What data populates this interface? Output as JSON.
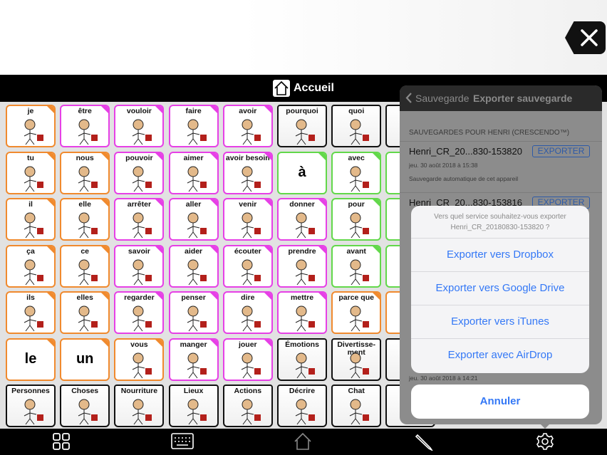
{
  "header": {
    "title": "Accueil",
    "home_icon": "home-icon",
    "clear_icon": "delete-x-icon"
  },
  "colors": {
    "pronoun": "#f08a2e",
    "verb": "#e640e6",
    "preposition": "#62d84a",
    "folder": "#111111",
    "link": "#3478f6"
  },
  "grid": {
    "rows": [
      [
        {
          "label": "je",
          "type": "pronoun"
        },
        {
          "label": "être",
          "type": "verb"
        },
        {
          "label": "vouloir",
          "type": "verb"
        },
        {
          "label": "faire",
          "type": "verb"
        },
        {
          "label": "avoir",
          "type": "verb"
        },
        {
          "label": "pourquoi",
          "type": "folder"
        },
        {
          "label": "quoi",
          "type": "folder"
        },
        {
          "label": "",
          "type": "folder"
        }
      ],
      [
        {
          "label": "tu",
          "type": "pronoun"
        },
        {
          "label": "nous",
          "type": "pronoun"
        },
        {
          "label": "pouvoir",
          "type": "verb"
        },
        {
          "label": "aimer",
          "type": "verb"
        },
        {
          "label": "avoir besoin",
          "type": "verb"
        },
        {
          "big": "à",
          "type": "preposition"
        },
        {
          "label": "avec",
          "type": "preposition"
        },
        {
          "label": "",
          "type": "preposition"
        }
      ],
      [
        {
          "label": "il",
          "type": "pronoun"
        },
        {
          "label": "elle",
          "type": "pronoun"
        },
        {
          "label": "arrêter",
          "type": "verb"
        },
        {
          "label": "aller",
          "type": "verb"
        },
        {
          "label": "venir",
          "type": "verb"
        },
        {
          "label": "donner",
          "type": "verb"
        },
        {
          "label": "pour",
          "type": "preposition"
        },
        {
          "label": "",
          "type": "preposition"
        }
      ],
      [
        {
          "label": "ça",
          "type": "pronoun"
        },
        {
          "label": "ce",
          "type": "pronoun"
        },
        {
          "label": "savoir",
          "type": "verb"
        },
        {
          "label": "aider",
          "type": "verb"
        },
        {
          "label": "écouter",
          "type": "verb"
        },
        {
          "label": "prendre",
          "type": "verb"
        },
        {
          "label": "avant",
          "type": "preposition"
        },
        {
          "label": "",
          "type": "preposition"
        }
      ],
      [
        {
          "label": "ils",
          "type": "pronoun"
        },
        {
          "label": "elles",
          "type": "pronoun"
        },
        {
          "label": "regarder",
          "type": "verb"
        },
        {
          "label": "penser",
          "type": "verb"
        },
        {
          "label": "dire",
          "type": "verb"
        },
        {
          "label": "mettre",
          "type": "verb"
        },
        {
          "label": "parce que",
          "type": "pronoun"
        },
        {
          "label": "",
          "type": "pronoun"
        }
      ],
      [
        {
          "big": "le",
          "type": "pronoun"
        },
        {
          "big": "un",
          "type": "pronoun"
        },
        {
          "label": "vous",
          "type": "pronoun"
        },
        {
          "label": "manger",
          "type": "verb"
        },
        {
          "label": "jouer",
          "type": "verb"
        },
        {
          "label": "Émotions",
          "type": "folder"
        },
        {
          "label": "Divertisse-ment",
          "type": "folder"
        },
        {
          "label": "",
          "type": "folder"
        }
      ],
      [
        {
          "label": "Personnes",
          "type": "folder"
        },
        {
          "label": "Choses",
          "type": "folder"
        },
        {
          "label": "Nourriture",
          "type": "folder"
        },
        {
          "label": "Lieux",
          "type": "folder"
        },
        {
          "label": "Actions",
          "type": "folder"
        },
        {
          "label": "Décrire",
          "type": "folder"
        },
        {
          "label": "Chat",
          "type": "folder"
        },
        {
          "label": "",
          "type": "folder"
        }
      ]
    ]
  },
  "toolbar": {
    "icons": [
      "grid-icon",
      "keyboard-icon",
      "home-icon",
      "pencil-icon",
      "gear-icon"
    ]
  },
  "popover": {
    "back_label": "Sauvegarde",
    "title": "Exporter sauvegarde",
    "section": "SAUVEGARDES POUR HENRI (CRESCENDO™)",
    "backups": [
      {
        "name": "Henri_CR_20...830-153820",
        "date": "jeu. 30 août 2018 à 15:38",
        "desc": "Sauvegarde automatique de cet appareil",
        "button": "EXPORTER"
      },
      {
        "name": "Henri_CR_20...830-153816",
        "button": "EXPORTER"
      }
    ],
    "partial_date": "jeu. 30 août 2018 à 14:21"
  },
  "sheet": {
    "message": "Vers quel service souhaitez-vous exporter Henri_CR_20180830-153820 ?",
    "options": [
      "Exporter vers Dropbox",
      "Exporter vers Google Drive",
      "Exporter vers iTunes",
      "Exporter avec AirDrop"
    ],
    "cancel": "Annuler"
  }
}
